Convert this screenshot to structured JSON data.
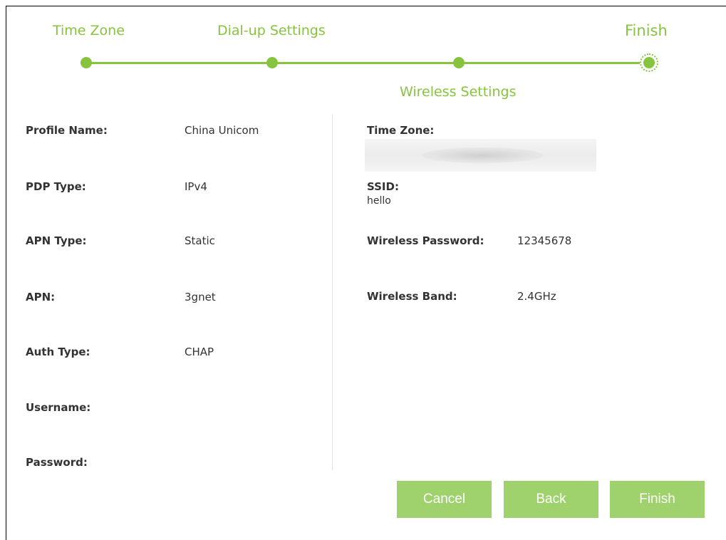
{
  "stepper": {
    "steps": [
      {
        "label": "Time Zone"
      },
      {
        "label": "Dial-up Settings"
      },
      {
        "label": "Wireless Settings"
      },
      {
        "label": "Finish"
      }
    ]
  },
  "dialup": {
    "profile_name": {
      "label": "Profile Name:",
      "value": "China Unicom"
    },
    "pdp_type": {
      "label": "PDP Type:",
      "value": "IPv4"
    },
    "apn_type": {
      "label": "APN Type:",
      "value": "Static"
    },
    "apn": {
      "label": "APN:",
      "value": "3gnet"
    },
    "auth_type": {
      "label": "Auth Type:",
      "value": "CHAP"
    },
    "username": {
      "label": "Username:",
      "value": ""
    },
    "password": {
      "label": "Password:",
      "value": ""
    }
  },
  "wireless": {
    "time_zone": {
      "label": "Time Zone:"
    },
    "ssid": {
      "label": "SSID:",
      "value": "hello"
    },
    "wireless_password": {
      "label": "Wireless Password:",
      "value": "12345678"
    },
    "wireless_band": {
      "label": "Wireless Band:",
      "value": "2.4GHz"
    }
  },
  "buttons": {
    "cancel": "Cancel",
    "back": "Back",
    "finish": "Finish"
  },
  "colors": {
    "accent": "#86c440",
    "button": "#9fd26d"
  }
}
